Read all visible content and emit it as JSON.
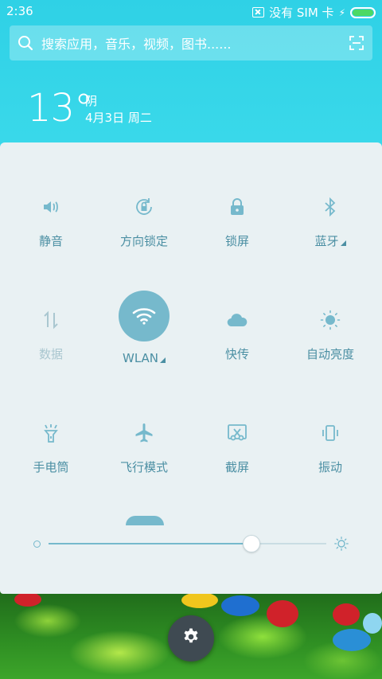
{
  "status_bar": {
    "time": "2:36",
    "sim_text": "没有 SIM 卡",
    "bolt": "⚡"
  },
  "search": {
    "placeholder": "搜索应用，音乐，视频，图书......"
  },
  "weather": {
    "temperature": "13°",
    "condition": "阴",
    "date": "4月3日 周二"
  },
  "tiles": [
    {
      "label": "静音",
      "icon": "volume-icon",
      "enabled": true
    },
    {
      "label": "方向锁定",
      "icon": "rotation-lock-icon",
      "enabled": true
    },
    {
      "label": "锁屏",
      "icon": "lock-icon",
      "enabled": true
    },
    {
      "label": "蓝牙",
      "icon": "bluetooth-icon",
      "enabled": true,
      "has_menu": true
    },
    {
      "label": "数据",
      "icon": "mobile-data-icon",
      "enabled": false
    },
    {
      "label": "WLAN",
      "icon": "wifi-icon",
      "enabled": true,
      "active": true,
      "has_menu": true
    },
    {
      "label": "快传",
      "icon": "cloud-icon",
      "enabled": true
    },
    {
      "label": "自动亮度",
      "icon": "auto-brightness-icon",
      "enabled": true
    },
    {
      "label": "手电筒",
      "icon": "flashlight-icon",
      "enabled": true
    },
    {
      "label": "飞行模式",
      "icon": "airplane-icon",
      "enabled": true
    },
    {
      "label": "截屏",
      "icon": "screenshot-icon",
      "enabled": true
    },
    {
      "label": "振动",
      "icon": "vibrate-icon",
      "enabled": true
    }
  ],
  "brightness": {
    "level": 0.73
  },
  "colors": {
    "accent": "#76b9cc",
    "label": "#4b8fa3",
    "panel": "#e9f1f3",
    "header": "#2fd1e6"
  }
}
